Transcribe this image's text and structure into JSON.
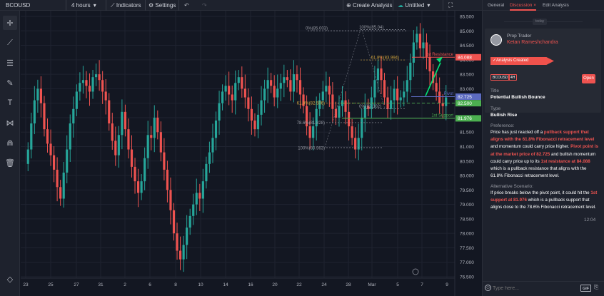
{
  "toolbar": {
    "symbol": "BCOUSD",
    "interval": "4 hours",
    "indicators": "Indicators",
    "settings": "Settings",
    "create_analysis": "Create Analysis",
    "untitled": "Untitled"
  },
  "panel": {
    "tabs": [
      "General",
      "Discussion",
      "Edit Analysis"
    ],
    "tab_close": "×",
    "date_chip": "today",
    "author_role": "Prop Trader",
    "author_name": "Ketan Rameshchandra",
    "status": "Analysis Created",
    "tags": [
      "BCOUSD",
      "4H"
    ],
    "open_label": "Open",
    "title_label": "Title",
    "title_value": "Potential Bullish Bounce",
    "type_label": "Type",
    "type_value": "Bullish Rise",
    "preference_label": "Preference:",
    "preference_segments": [
      {
        "t": "Price has just reacted off a ",
        "hl": false
      },
      {
        "t": "pullback support that aligns with the 61.8% Fibonacci retracement level",
        "hl": true
      },
      {
        "t": " and momentum could carry price higher. ",
        "hl": false
      },
      {
        "t": "Pivot point is at the market price of 82.725",
        "hl": true
      },
      {
        "t": " and bullish momentum could carry price up to its ",
        "hl": false
      },
      {
        "t": "1st resistance at 84.088",
        "hl": true
      },
      {
        "t": " which is a pullback resistance that aligns with the 61.8% Fibonacci retracement level.",
        "hl": false
      }
    ],
    "alternative_label": "Alternative Scenario:",
    "alternative_segments": [
      {
        "t": "If price breaks below the pivot point, it could hit the ",
        "hl": false
      },
      {
        "t": "1st support at 81.976",
        "hl": true
      },
      {
        "t": " which is a pullback support that aligns close to the 78.6% Fibonacci retracement level.",
        "hl": false
      }
    ],
    "time": "12:04",
    "input_placeholder": "Type here...",
    "gif_label": "GIF"
  },
  "chart_data": {
    "type": "candlestick",
    "symbol": "BCOUSD",
    "ylim": [
      76.5,
      85.5
    ],
    "y_ticks": [
      "85.500",
      "85.000",
      "84.500",
      "84.000",
      "83.500",
      "83.000",
      "82.500",
      "82.000",
      "81.500",
      "81.000",
      "80.500",
      "80.000",
      "79.500",
      "79.000",
      "78.500",
      "78.000",
      "77.500",
      "77.000",
      "76.500"
    ],
    "x_ticks": [
      "23",
      "25",
      "27",
      "31",
      "2",
      "6",
      "8",
      "10",
      "14",
      "16",
      "20",
      "22",
      "24",
      "28",
      "Mar",
      "5",
      "7",
      "9"
    ],
    "colors": {
      "up": "#26a69a",
      "down": "#ef5350",
      "resistance": "#ef5350",
      "pivot": "#5c6bc0",
      "support": "#4caf50",
      "fib": "#9598a1",
      "fib_mid": "#cfa33c",
      "arrow": "#00e676"
    },
    "levels": [
      {
        "name": "1st Resistance",
        "value": 84.088
      },
      {
        "name": "Pivot",
        "value": 82.725
      },
      {
        "name": "1st Support",
        "value": 81.976
      }
    ],
    "price_labels": [
      "84.088",
      "82.725",
      "82.500",
      "81.976"
    ],
    "fib_up": [
      {
        "label": "100%(80.963)",
        "value": 80.963
      },
      {
        "label": "78.6%(81.828)",
        "value": 81.828
      },
      {
        "label": "61.8%(82.506)",
        "value": 82.506
      }
    ],
    "fib_down": [
      {
        "label": "0%(85.003)",
        "value": 85.003
      },
      {
        "label": "100%(85.04)",
        "value": 85.04
      },
      {
        "label": "61.8%(83.994)",
        "value": 83.994
      },
      {
        "label": "0%(82.302)",
        "value": 82.302
      }
    ],
    "closes": [
      80.9,
      81.8,
      82.6,
      83.0,
      82.5,
      81.6,
      81.1,
      80.7,
      80.2,
      79.6,
      79.2,
      80.1,
      80.9,
      81.8,
      82.3,
      82.9,
      83.2,
      83.3,
      83.1,
      82.9,
      83.4,
      83.5,
      83.3,
      82.9,
      82.6,
      81.8,
      81.2,
      80.7,
      81.4,
      82.2,
      81.6,
      80.9,
      80.3,
      79.8,
      79.4,
      79.8,
      80.6,
      81.4,
      81.3,
      82.0,
      81.5,
      80.8,
      80.2,
      79.5,
      78.8,
      78.0,
      77.4,
      77.1,
      77.6,
      78.2,
      78.6,
      79.0,
      79.4,
      79.2,
      79.8,
      80.4,
      80.8,
      81.3,
      81.9,
      82.5,
      82.9,
      83.1,
      82.8,
      82.6,
      83.2,
      83.4,
      83.0,
      82.7,
      82.3,
      81.9,
      81.6,
      82.1,
      82.6,
      83.0,
      83.3,
      83.1,
      82.7,
      83.0,
      83.2,
      83.4,
      83.3,
      82.9,
      83.5,
      83.3,
      82.8,
      82.4,
      81.7,
      81.3,
      81.7,
      82.3,
      82.6,
      82.9,
      83.1,
      82.8,
      82.3,
      82.0,
      82.4,
      82.6,
      82.2,
      81.7,
      81.3,
      80.9,
      81.3,
      82.0,
      82.4,
      82.3,
      82.7,
      83.3,
      83.7,
      83.3,
      82.7,
      82.3,
      82.6,
      83.0,
      82.6,
      82.7,
      82.9,
      83.3,
      83.9,
      84.6,
      84.9,
      84.4,
      84.6,
      84.1,
      83.6,
      83.2,
      82.9,
      82.5,
      82.4,
      82.7
    ]
  }
}
